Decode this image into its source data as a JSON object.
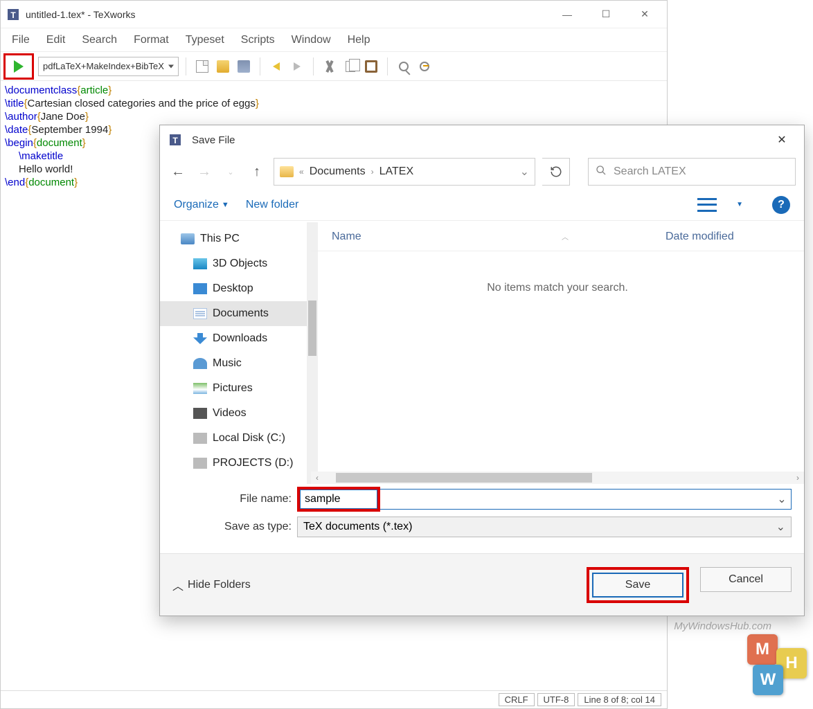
{
  "main": {
    "title": "untitled-1.tex* - TeXworks",
    "menus": [
      "File",
      "Edit",
      "Search",
      "Format",
      "Typeset",
      "Scripts",
      "Window",
      "Help"
    ],
    "engine": "pdfLaTeX+MakeIndex+BibTeX"
  },
  "code": {
    "l1_cmd": "\\documentclass",
    "l1_arg": "article",
    "l2_cmd": "\\title",
    "l2_text": "Cartesian closed categories and the price of eggs",
    "l3_cmd": "\\author",
    "l3_text": "Jane Doe",
    "l4_cmd": "\\date",
    "l4_text": "September 1994",
    "l5_cmd": "\\begin",
    "l5_arg": "document",
    "l6_cmd": "\\maketitle",
    "l7_text": "Hello world!",
    "l8_cmd": "\\end",
    "l8_arg": "document"
  },
  "status": {
    "eol": "CRLF",
    "enc": "UTF-8",
    "pos": "Line 8 of 8; col 14"
  },
  "dialog": {
    "title": "Save File",
    "breadcrumb": {
      "seg0": "«",
      "seg1": "Documents",
      "seg2": "LATEX"
    },
    "search_placeholder": "Search LATEX",
    "organize": "Organize",
    "new_folder": "New folder",
    "tree": {
      "thispc": "This PC",
      "items": [
        "3D Objects",
        "Desktop",
        "Documents",
        "Downloads",
        "Music",
        "Pictures",
        "Videos",
        "Local Disk (C:)",
        "PROJECTS (D:)"
      ]
    },
    "columns": {
      "name": "Name",
      "date": "Date modified"
    },
    "empty": "No items match your search.",
    "filename_label": "File name:",
    "filename_value": "sample",
    "type_label": "Save as type:",
    "type_value": "TeX documents (*.tex)",
    "hide_folders": "Hide Folders",
    "save": "Save",
    "cancel": "Cancel"
  },
  "watermark": "MyWindowsHub.com",
  "brand": {
    "m": "M",
    "w": "W",
    "h": "H"
  }
}
